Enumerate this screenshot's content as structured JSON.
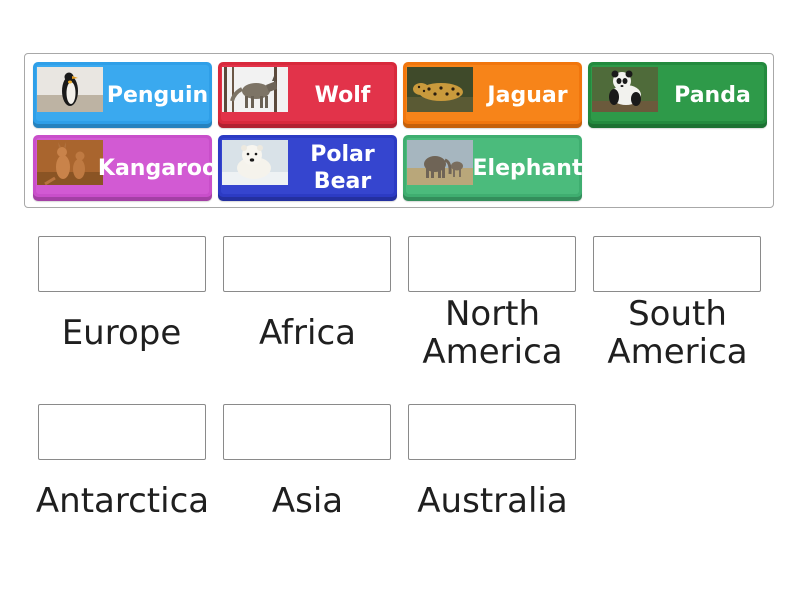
{
  "tiles": [
    {
      "label": "Penguin",
      "color": "#2f9fe8",
      "inner": "#3aa9ef",
      "icon": "penguin-photo"
    },
    {
      "label": "Wolf",
      "color": "#d8293c",
      "inner": "#e2334a",
      "icon": "wolf-photo"
    },
    {
      "label": "Jaguar",
      "color": "#f1760d",
      "inner": "#f78419",
      "icon": "jaguar-photo"
    },
    {
      "label": "Panda",
      "color": "#238a3e",
      "inner": "#2e9a49",
      "icon": "panda-photo"
    },
    {
      "label": "Kangaroo",
      "color": "#c94fca",
      "inner": "#d25ad3",
      "icon": "kangaroo-photo"
    },
    {
      "label": "Polar Bear",
      "color": "#2c3bc4",
      "inner": "#3545cf",
      "icon": "polar-bear-photo"
    },
    {
      "label": "Elephant",
      "color": "#3fae70",
      "inner": "#4bbb7c",
      "icon": "elephant-photo"
    }
  ],
  "categories": [
    {
      "label": "Europe"
    },
    {
      "label": "Africa"
    },
    {
      "label": "North America"
    },
    {
      "label": "South America"
    },
    {
      "label": "Antarctica"
    },
    {
      "label": "Asia"
    },
    {
      "label": "Australia"
    }
  ]
}
